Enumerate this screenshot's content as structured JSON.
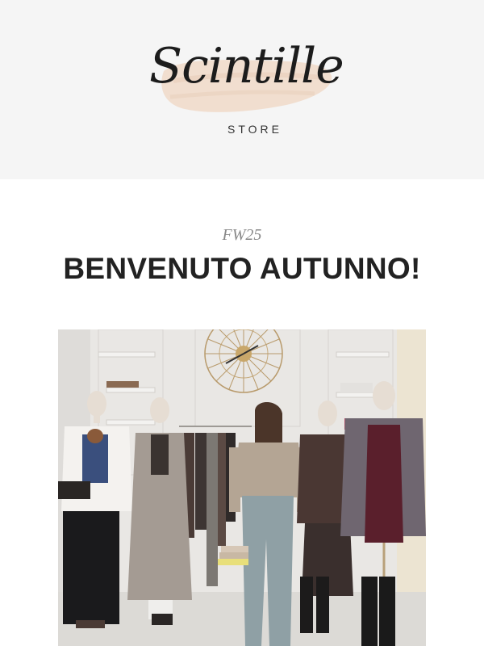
{
  "header": {
    "logo_script": "Scintille",
    "logo_sub": "STORE",
    "brush_color": "#f1dccb"
  },
  "hero": {
    "season": "FW25",
    "headline": "BENVENUTO AUTUNNO!"
  },
  "photo": {
    "subject": "store-interior-photo"
  }
}
